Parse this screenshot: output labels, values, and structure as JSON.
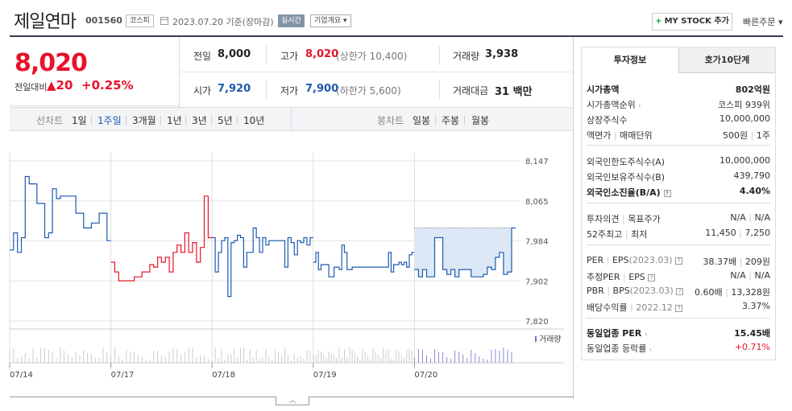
{
  "header": {
    "stock_name": "제일연마",
    "stock_code": "001560",
    "market_tag": "코스피",
    "date_text": "2023.07.20 기준(장마감)",
    "live_badge": "실시간",
    "company_button": "기업개요",
    "mystock_button": "MY STOCK 추가",
    "quick_order": "빠른주문"
  },
  "price": {
    "current": "8,020",
    "prev_label": "전일대비",
    "change": "20",
    "change_pct": "+0.25%"
  },
  "summary": {
    "prev_close_label": "전일",
    "prev_close": "8,000",
    "high_label": "고가",
    "high": "8,020",
    "upper_limit": "(상한가 10,400)",
    "volume_label": "거래량",
    "volume": "3,938",
    "open_label": "시가",
    "open": "7,920",
    "low_label": "저가",
    "low": "7,900",
    "lower_limit": "(하한가 5,600)",
    "amount_label": "거래대금",
    "amount": "31 백만"
  },
  "chart_tabs": {
    "line_label": "선차트",
    "periods": [
      "1일",
      "1주일",
      "3개월",
      "1년",
      "3년",
      "5년",
      "10년"
    ],
    "selected_period": "1주일",
    "candle_label": "봉차트",
    "candles": [
      "일봉",
      "주봉",
      "월봉"
    ]
  },
  "chart_data": {
    "type": "line",
    "y_ticks": [
      "8,147",
      "8,065",
      "7,984",
      "7,902",
      "7,820"
    ],
    "ylim": [
      7820,
      8147
    ],
    "x_ticks": [
      "07/14",
      "07/17",
      "07/18",
      "07/19",
      "07/20"
    ],
    "volume_label": "거래량",
    "colors": {
      "up": "#e8132b",
      "down": "#1c5bb0",
      "fill": "#dce8f6",
      "grid": "#e4e4e4"
    },
    "series": [
      {
        "values": [
          7965,
          8000,
          7960,
          7990,
          8115,
          8100,
          8100,
          8060,
          8060,
          7990,
          8000,
          8090,
          8070,
          8075,
          8075,
          8075,
          8075,
          8040,
          8040,
          8010,
          8010,
          8020,
          8020,
          8040,
          8040,
          7984
        ]
      },
      {
        "values": [
          7940,
          7920,
          7902,
          7902,
          7902,
          7902,
          7910,
          7910,
          7920,
          7920,
          7935,
          7930,
          7950,
          7940,
          7950,
          7920,
          7960,
          7975,
          7960,
          8000,
          7960,
          7980,
          7940,
          7970,
          8075,
          7990
        ]
      },
      {
        "values": [
          7990,
          7920,
          7960,
          7984,
          7990,
          7870,
          7980,
          7984,
          7995,
          7990,
          7930,
          7960,
          7960,
          8010,
          7990,
          7960,
          7990,
          7975,
          7984,
          7984,
          7984,
          7984,
          7984,
          7930,
          7990,
          7980,
          7955,
          7984,
          7980,
          7990,
          7975,
          7990
        ]
      },
      {
        "values": [
          7940,
          7960,
          7925,
          7935,
          7935,
          7935,
          7910,
          7910,
          7930,
          7930,
          7925,
          7975,
          7960,
          7925,
          7925,
          7930,
          7930,
          7930,
          7930,
          7930,
          7930,
          7930,
          7930,
          7930,
          7930,
          7930,
          7930,
          7930,
          7930,
          7960,
          7920,
          7935,
          7935,
          7940,
          7935,
          7940,
          7930,
          7955,
          7960
        ]
      },
      {
        "values": [
          7925,
          7910,
          7925,
          7910,
          7910,
          7990,
          7990,
          7925,
          7915,
          7925,
          7910,
          7925,
          7925,
          7925,
          7910,
          7910,
          7910,
          7915,
          7930,
          7925,
          7950,
          7960,
          7915,
          7920,
          8010
        ]
      }
    ]
  },
  "invest_panel": {
    "tab_active": "투자정보",
    "tab_other": "호가10단계",
    "market_cap_label": "시가총액",
    "market_cap": "802억원",
    "cap_rank_label": "시가총액순위",
    "cap_rank": "코스피 939위",
    "shares_label": "상장주식수",
    "shares": "10,000,000",
    "par_label": "액면가",
    "trade_unit_label": "매매단위",
    "par": "500원",
    "trade_unit": "1주",
    "foreign_limit_label": "외국인한도주식수(A)",
    "foreign_limit": "10,000,000",
    "foreign_hold_label": "외국인보유주식수(B)",
    "foreign_hold": "439,790",
    "foreign_rate_label": "외국인소진율(B/A)",
    "foreign_rate": "4.40%",
    "opinion_label": "투자의견",
    "target_label": "목표주가",
    "opinion": "N/A",
    "target": "N/A",
    "w52_label": "52주최고",
    "w52_low_label": "최저",
    "w52_high": "11,450",
    "w52_low": "7,250",
    "per_label": "PER",
    "eps_label": "EPS",
    "eps_period": "(2023.03)",
    "per": "38.37배",
    "eps": "209원",
    "est_per_label": "추정PER",
    "est_eps_label": "EPS",
    "est_per": "N/A",
    "est_eps": "N/A",
    "pbr_label": "PBR",
    "bps_label": "BPS",
    "bps_period": "(2023.03)",
    "pbr": "0.60배",
    "bps": "13,328원",
    "div_label": "배당수익률",
    "div_period": "2022.12",
    "div": "3.37%",
    "sector_per_label": "동일업종 PER",
    "sector_per": "15.45배",
    "sector_rate_label": "동일업종 등락률",
    "sector_rate": "+0.71%"
  }
}
